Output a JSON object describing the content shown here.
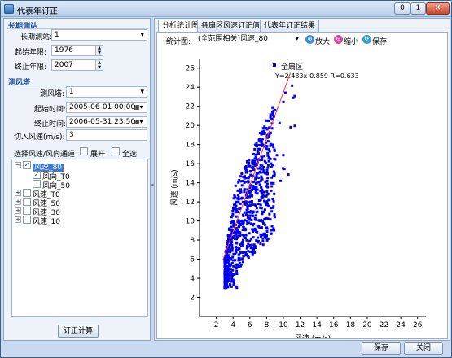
{
  "window": {
    "title": "代表年订正",
    "controls": [
      "0",
      "1",
      "r"
    ]
  },
  "ghost": [
    "",
    "",
    "",
    "",
    ""
  ],
  "left": {
    "long_term_group": "长期测站",
    "long_term_label": "长期测站:",
    "long_term_value": "1",
    "start_year_label": "起始年限:",
    "start_year": "1976",
    "end_year_label": "终止年限:",
    "end_year": "2007",
    "tower_group": "测风塔",
    "tower_label": "测风塔:",
    "tower_value": "1",
    "start_time_label": "起始时间:",
    "start_time": "2005-06-01 00:00",
    "end_time_label": "终止时间:",
    "end_time": "2006-05-31 23:50",
    "cutin_label": "切入风速(m/s):",
    "cutin_value": "3",
    "channel_label": "选择风速/风向通道",
    "expand_label": "展开",
    "select_all_label": "全选",
    "tree": [
      {
        "label": "风速_80",
        "checked": true,
        "expanded": true,
        "selected": true,
        "children": [
          {
            "label": "风向_T0",
            "checked": true
          },
          {
            "label": "风向_50",
            "checked": false
          }
        ]
      },
      {
        "label": "风速_T0",
        "checked": false,
        "expanded": false
      },
      {
        "label": "风速_50",
        "checked": false,
        "expanded": false
      },
      {
        "label": "风速_30",
        "checked": false,
        "expanded": false
      },
      {
        "label": "风速_10",
        "checked": false,
        "expanded": false
      }
    ],
    "calc_button": "订正计算"
  },
  "right": {
    "tabs": [
      "分析统计图",
      "各扇区风速订正值",
      "代表年订正结果"
    ],
    "active_tab": 0,
    "stat_label": "统计图:",
    "stat_value": "(全范围相关)风速_80",
    "zoom_in": "放大",
    "zoom_out": "缩小",
    "save_chart": "保存"
  },
  "chart_data": {
    "type": "scatter",
    "legend": "全扇区",
    "equation": "Y=2.433x-0.859 R=0.633",
    "xlabel": "风速 (m/s)",
    "ylabel": "风速 (m/s)",
    "xlim": [
      0,
      27
    ],
    "ylim": [
      0,
      27
    ],
    "xticks": [
      2,
      4,
      6,
      8,
      10,
      12,
      14,
      16,
      18,
      20,
      22,
      24,
      26
    ],
    "yticks": [
      2,
      4,
      6,
      8,
      10,
      12,
      14,
      16,
      18,
      20,
      22,
      24,
      26
    ],
    "fit": {
      "slope": 2.433,
      "intercept": -0.859,
      "color": "#ff3030"
    },
    "point_color": "#0000ee",
    "point_count": 800
  },
  "footer": {
    "save": "保存",
    "close": "关闭"
  }
}
